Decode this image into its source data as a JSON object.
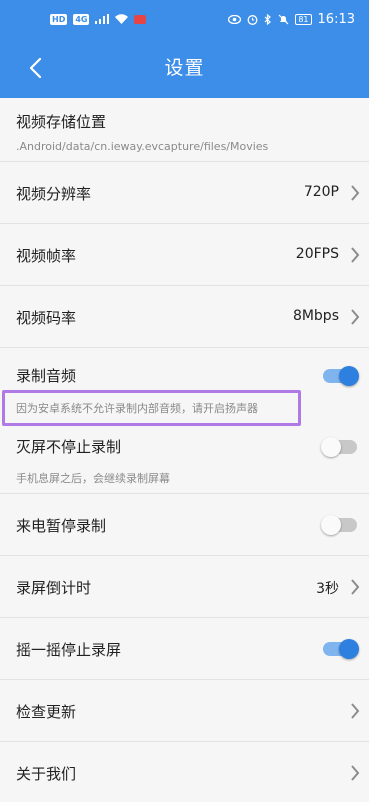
{
  "status_bar": {
    "network_chips": [
      "HD",
      "4G"
    ],
    "battery": "81",
    "time": "16:13"
  },
  "app_bar": {
    "title": "设置",
    "back_icon": "chevron-left-icon"
  },
  "settings": {
    "storage": {
      "label": "视频存储位置",
      "path": ".Android/data/cn.ieway.evcapture/files/Movies"
    },
    "resolution": {
      "label": "视频分辨率",
      "value": "720P"
    },
    "framerate": {
      "label": "视频帧率",
      "value": "20FPS"
    },
    "bitrate": {
      "label": "视频码率",
      "value": "8Mbps"
    },
    "record_audio": {
      "label": "录制音频",
      "enabled": true,
      "note": "因为安卓系统不允许录制内部音频，请开启扬声器"
    },
    "screen_off": {
      "label": "灭屏不停止录制",
      "enabled": false,
      "note": "手机息屏之后，会继续录制屏幕"
    },
    "call_pause": {
      "label": "来电暂停录制",
      "enabled": false
    },
    "countdown": {
      "label": "录屏倒计时",
      "value": "3秒"
    },
    "shake_stop": {
      "label": "摇一摇停止录屏",
      "enabled": true
    },
    "check_update": {
      "label": "检查更新"
    },
    "about": {
      "label": "关于我们"
    }
  },
  "colors": {
    "primary": "#3d8ee8",
    "toggle_on": "#2d7fe0",
    "highlight_border": "#b07ae6"
  }
}
